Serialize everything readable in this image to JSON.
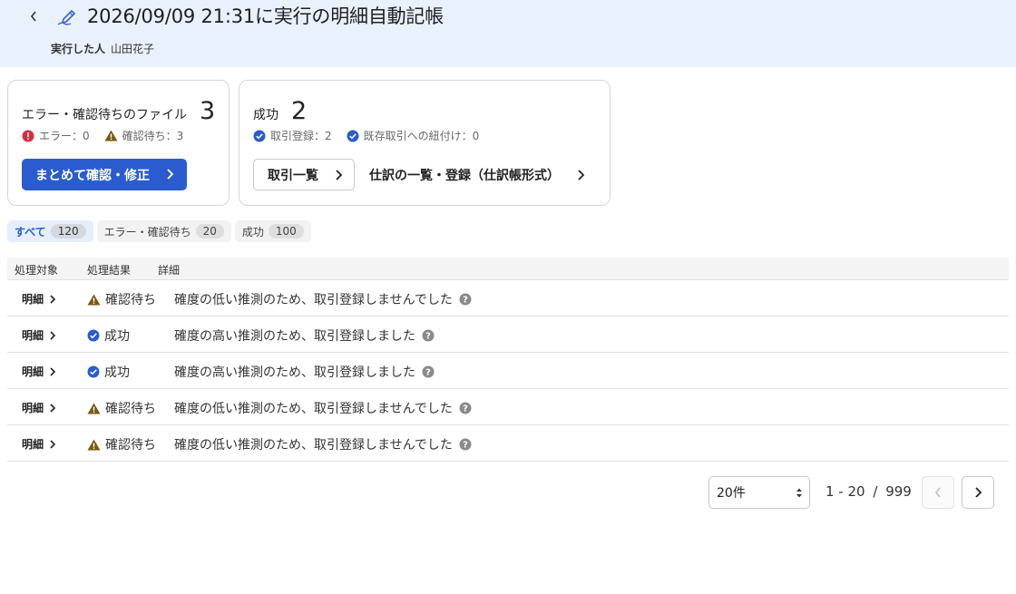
{
  "header": {
    "title": "2026/09/09 21:31に実行の明細自動記帳",
    "executor_label": "実行した人",
    "executor_name": "山田花子"
  },
  "summary": {
    "pending_card": {
      "label": "エラー・確認待ちのファイル",
      "count": "3",
      "error_stat": "エラー：0",
      "pending_stat": "確認待ち：3",
      "bulk_button": "まとめて確認・修正"
    },
    "success_card": {
      "label": "成功",
      "count": "2",
      "registered_stat": "取引登録：2",
      "linked_stat": "既存取引への紐付け：0",
      "transactions_button": "取引一覧",
      "journal_link": "仕訳の一覧・登録（仕訳帳形式）"
    }
  },
  "tabs": [
    {
      "label": "すべて",
      "count": "120"
    },
    {
      "label": "エラー・確認待ち",
      "count": "20"
    },
    {
      "label": "成功",
      "count": "100"
    }
  ],
  "table": {
    "headers": [
      "処理対象",
      "処理結果",
      "詳細"
    ],
    "rows": [
      {
        "target": "明細",
        "status": "warning",
        "result": "確認待ち",
        "detail": "確度の低い推測のため、取引登録しませんでした"
      },
      {
        "target": "明細",
        "status": "success",
        "result": "成功",
        "detail": "確度の高い推測のため、取引登録しました"
      },
      {
        "target": "明細",
        "status": "success",
        "result": "成功",
        "detail": "確度の高い推測のため、取引登録しました"
      },
      {
        "target": "明細",
        "status": "warning",
        "result": "確認待ち",
        "detail": "確度の低い推測のため、取引登録しませんでした"
      },
      {
        "target": "明細",
        "status": "warning",
        "result": "確認待ち",
        "detail": "確度の低い推測のため、取引登録しませんでした"
      }
    ]
  },
  "pagination": {
    "per_page": "20件",
    "range": "1 - 20",
    "separator": "/",
    "total": "999"
  },
  "colors": {
    "accent": "#2a5ccf",
    "header_bg": "#e9f1fd",
    "warning": "#7a5a10",
    "error": "#d92d3c",
    "success": "#2a5ccf"
  },
  "icons": {
    "back": "chevron-left-icon",
    "title": "auto-book-pen-icon",
    "error": "error-icon",
    "warning": "warning-icon",
    "success": "check-circle-icon",
    "help": "help-icon",
    "chevron": "chevron-right-icon"
  }
}
